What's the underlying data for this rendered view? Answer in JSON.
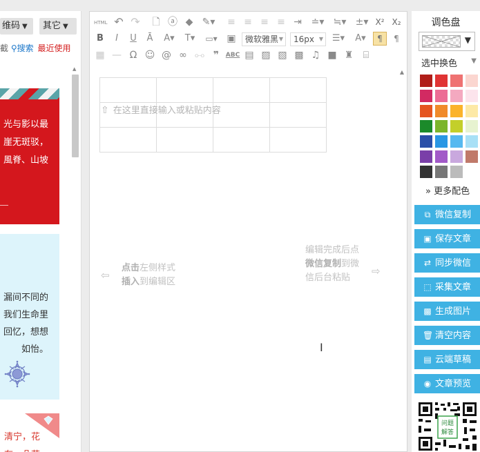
{
  "left_panel": {
    "qrcode_button": "维码",
    "other_button": "其它",
    "links": {
      "cut_text": "截",
      "search": "搜索",
      "recent": "最近使用"
    },
    "red_card_lines": [
      "光与影以最",
      "崖无斑驳，",
      "風脊、山坡"
    ],
    "blue_card_lines": [
      "漏间不同的",
      "我们生命里",
      "回忆，想想",
      "如怡。"
    ],
    "white_card_lines": [
      "清宁，花",
      "有一朵花"
    ]
  },
  "editor": {
    "toolbar": {
      "row1": [
        "HTML",
        "↶",
        "↷",
        "🗋",
        "ⓐ",
        "◆",
        "✎▾",
        "≡",
        "≡",
        "≡",
        "≡",
        "⇥",
        "≐▾",
        "≒▾",
        "±▾",
        "X²",
        "X₂"
      ],
      "row2_bold": "B",
      "row2_italic": "I",
      "row2_underline": "U",
      "font_family": "微软雅黑",
      "font_size": "16px",
      "row3_text_abc": "ABC"
    },
    "placeholder": "在这里直接输入或粘贴内容",
    "hint_left_bold1": "点击",
    "hint_left_rest1": "左侧样式",
    "hint_left_bold2": "插入",
    "hint_left_rest2": "到编辑区",
    "hint_right_line1": "编辑完成后点",
    "hint_right_bold": "微信复制",
    "hint_right_rest2": "到微",
    "hint_right_line3": "信后台粘贴"
  },
  "right_panel": {
    "palette_title": "调色盘",
    "select_swap": "选中换色",
    "more_colors": "更多配色",
    "swatch_colors": [
      "#b01e19",
      "#e03434",
      "#ef7272",
      "#fbd6d0",
      "#d22a62",
      "#ec6c95",
      "#f4a9c0",
      "#fce4ec",
      "#e55520",
      "#f08a2a",
      "#fbb32a",
      "#fde9a6",
      "#1b8a2a",
      "#7cb52c",
      "#c3cf2a",
      "#e7f3d0",
      "#2a4fa8",
      "#2a97e4",
      "#56b9f0",
      "#a8e0f6",
      "#7a3fa8",
      "#a25ac8",
      "#c9a8de",
      "#c07a6a",
      "#333333",
      "#777777",
      "#bbbbbb"
    ],
    "actions": [
      {
        "label": "微信复制",
        "icon": "copy-icon",
        "glyph": "⧉"
      },
      {
        "label": "保存文章",
        "icon": "save-icon",
        "glyph": "▣"
      },
      {
        "label": "同步微信",
        "icon": "sync-icon",
        "glyph": "⇄"
      },
      {
        "label": "采集文章",
        "icon": "collect-icon",
        "glyph": "⬚"
      },
      {
        "label": "生成图片",
        "icon": "image-icon",
        "glyph": "▩"
      },
      {
        "label": "清空内容",
        "icon": "trash-icon",
        "glyph": "🗑"
      },
      {
        "label": "云端草稿",
        "icon": "draft-icon",
        "glyph": "▤"
      },
      {
        "label": "文章预览",
        "icon": "eye-icon",
        "glyph": "◉"
      }
    ],
    "qr_caption": "问题\n解答"
  }
}
